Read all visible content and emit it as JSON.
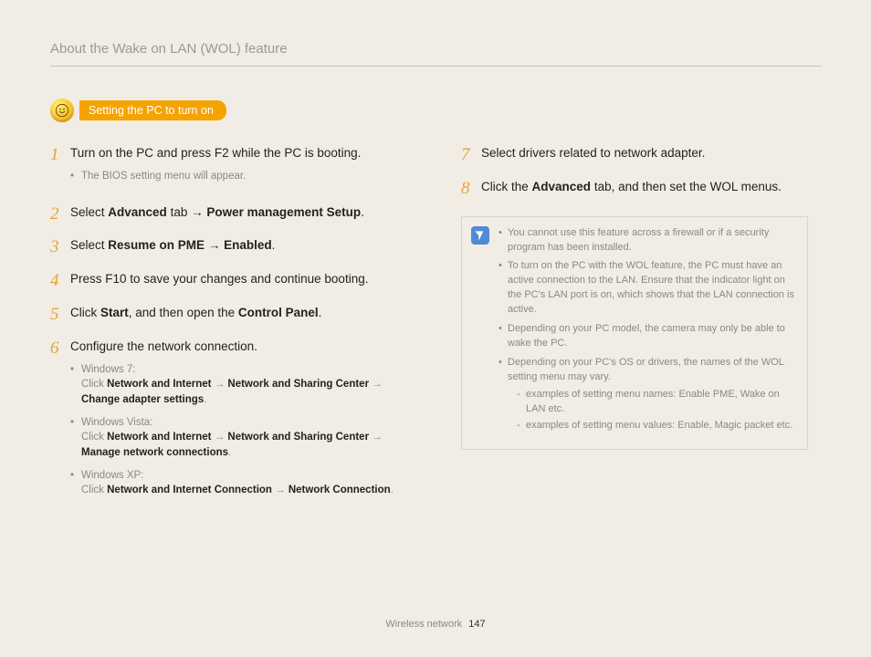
{
  "pageTitle": "About the Wake on LAN (WOL) feature",
  "section": {
    "header": "Setting the PC to turn on"
  },
  "steps": [
    {
      "num": "1",
      "html": "Turn on the PC and press F2 while the PC is booting.",
      "subs": [
        {
          "type": "note",
          "text": "The BIOS setting menu will appear."
        }
      ]
    },
    {
      "num": "2",
      "html": "Select <span class='b'>Advanced</span> tab → <span class='b'>Power management Setup</span>."
    },
    {
      "num": "3",
      "html": "Select <span class='b'>Resume on PME</span> → <span class='b'>Enabled</span>."
    },
    {
      "num": "4",
      "html": "Press F10 to save your changes and continue booting."
    },
    {
      "num": "5",
      "html": "Click <span class='b'>Start</span>, and then open the <span class='b'>Control Panel</span>."
    },
    {
      "num": "6",
      "html": "Configure the network connection.",
      "subs": [
        {
          "type": "os",
          "label": "Windows 7:",
          "body": "Click <span class='b'>Network and Internet</span> → <span class='b'>Network and Sharing Center</span> → <span class='b'>Change adapter settings</span>."
        },
        {
          "type": "os",
          "label": "Windows Vista:",
          "body": "Click <span class='b'>Network and Internet</span> → <span class='b'>Network and Sharing Center</span> → <span class='b'>Manage network connections</span>."
        },
        {
          "type": "os",
          "label": "Windows XP:",
          "body": "Click <span class='b'>Network and Internet Connection</span> → <span class='b'>Network Connection</span>."
        }
      ]
    }
  ],
  "stepsRight": [
    {
      "num": "7",
      "html": "Select drivers related to network adapter."
    },
    {
      "num": "8",
      "html": "Click the <span class='b'>Advanced</span> tab, and then set the WOL menus."
    }
  ],
  "notes": [
    "You cannot use this feature across a firewall or if a security program has been installed.",
    "To turn on the PC with the WOL feature, the PC must have an active connection to the LAN. Ensure that the indicator light on the PC's LAN port is on, which shows that the LAN connection is active.",
    "Depending on your PC model, the camera may only be able to wake the PC.",
    "Depending on your PC's OS or drivers, the names of the WOL setting menu may vary."
  ],
  "noteSubs": [
    "examples of setting menu names: Enable PME, Wake on LAN etc.",
    "examples of setting menu values: Enable, Magic packet etc."
  ],
  "footer": {
    "section": "Wireless network",
    "page": "147"
  }
}
